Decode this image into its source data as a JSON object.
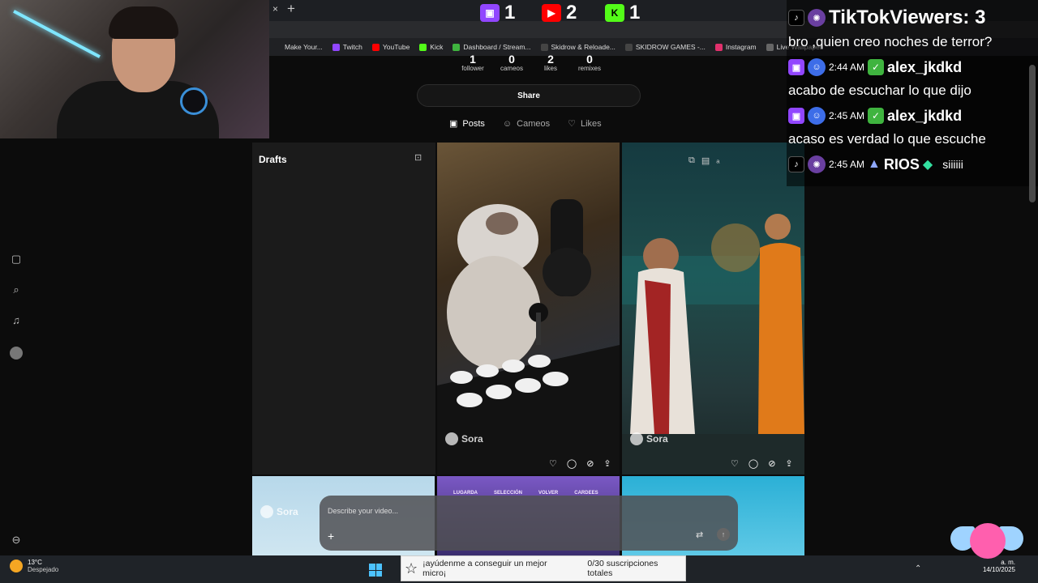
{
  "browser": {
    "tab_close": "×",
    "new_tab": "+",
    "bookmarks": [
      {
        "label": "Make Your...",
        "color": "#202124"
      },
      {
        "label": "Twitch",
        "color": "#9146ff"
      },
      {
        "label": "YouTube",
        "color": "#ff0000"
      },
      {
        "label": "Kick",
        "color": "#53fc18"
      },
      {
        "label": "Dashboard / Stream...",
        "color": "#3fb43f"
      },
      {
        "label": "Skidrow & Reloade...",
        "color": "#444"
      },
      {
        "label": "SKIDROW GAMES -...",
        "color": "#444"
      },
      {
        "label": "Instagram",
        "color": "#e1306c"
      },
      {
        "label": "Live Wallpaper",
        "color": "#666"
      }
    ]
  },
  "counters": [
    {
      "platform": "twitch",
      "value": "1",
      "color": "#9146ff"
    },
    {
      "platform": "youtube",
      "value": "2",
      "color": "#ff0000"
    },
    {
      "platform": "kick",
      "value": "1",
      "color": "#53fc18"
    }
  ],
  "profile": {
    "stats": [
      {
        "value": "1",
        "label": "follower"
      },
      {
        "value": "0",
        "label": "cameos"
      },
      {
        "value": "2",
        "label": "likes"
      },
      {
        "value": "0",
        "label": "remixes"
      }
    ],
    "share_label": "Share",
    "tabs": [
      {
        "label": "Posts",
        "active": true
      },
      {
        "label": "Cameos",
        "active": false
      },
      {
        "label": "Likes",
        "active": false
      }
    ]
  },
  "sidebar": {
    "icons": [
      "home-icon",
      "search-icon",
      "notifications-icon",
      "avatar"
    ]
  },
  "grid": {
    "drafts_title": "Drafts",
    "sora_label": "Sora"
  },
  "composer": {
    "placeholder": "Describe your video..."
  },
  "tile_text": {
    "menu": [
      "LUGARDA",
      "SELECCIÓN",
      "VOLVER",
      "CARDEES"
    ]
  },
  "chat": {
    "viewers_label": "TikTokViewers: 3",
    "messages": [
      {
        "time": "",
        "user": "",
        "text": "bro ,quien creo noches de terror?"
      },
      {
        "time": "2:44 AM",
        "user": "alex_jkdkd",
        "text": "acabo de escuchar lo que dijo"
      },
      {
        "time": "2:45 AM",
        "user": "alex_jkdkd",
        "text": "acaso es verdad lo que escuche"
      },
      {
        "time": "2:45 AM",
        "user": "RIOS",
        "text": "siiiiii"
      }
    ]
  },
  "taskbar": {
    "weather_temp": "13°C",
    "weather_desc": "Despejado",
    "banner_text": "¡ayúdenme a conseguir un mejor micro¡",
    "banner_count": "0/30 suscripciones totales",
    "date": "14/10/2025",
    "time_suffix": "a. m."
  }
}
